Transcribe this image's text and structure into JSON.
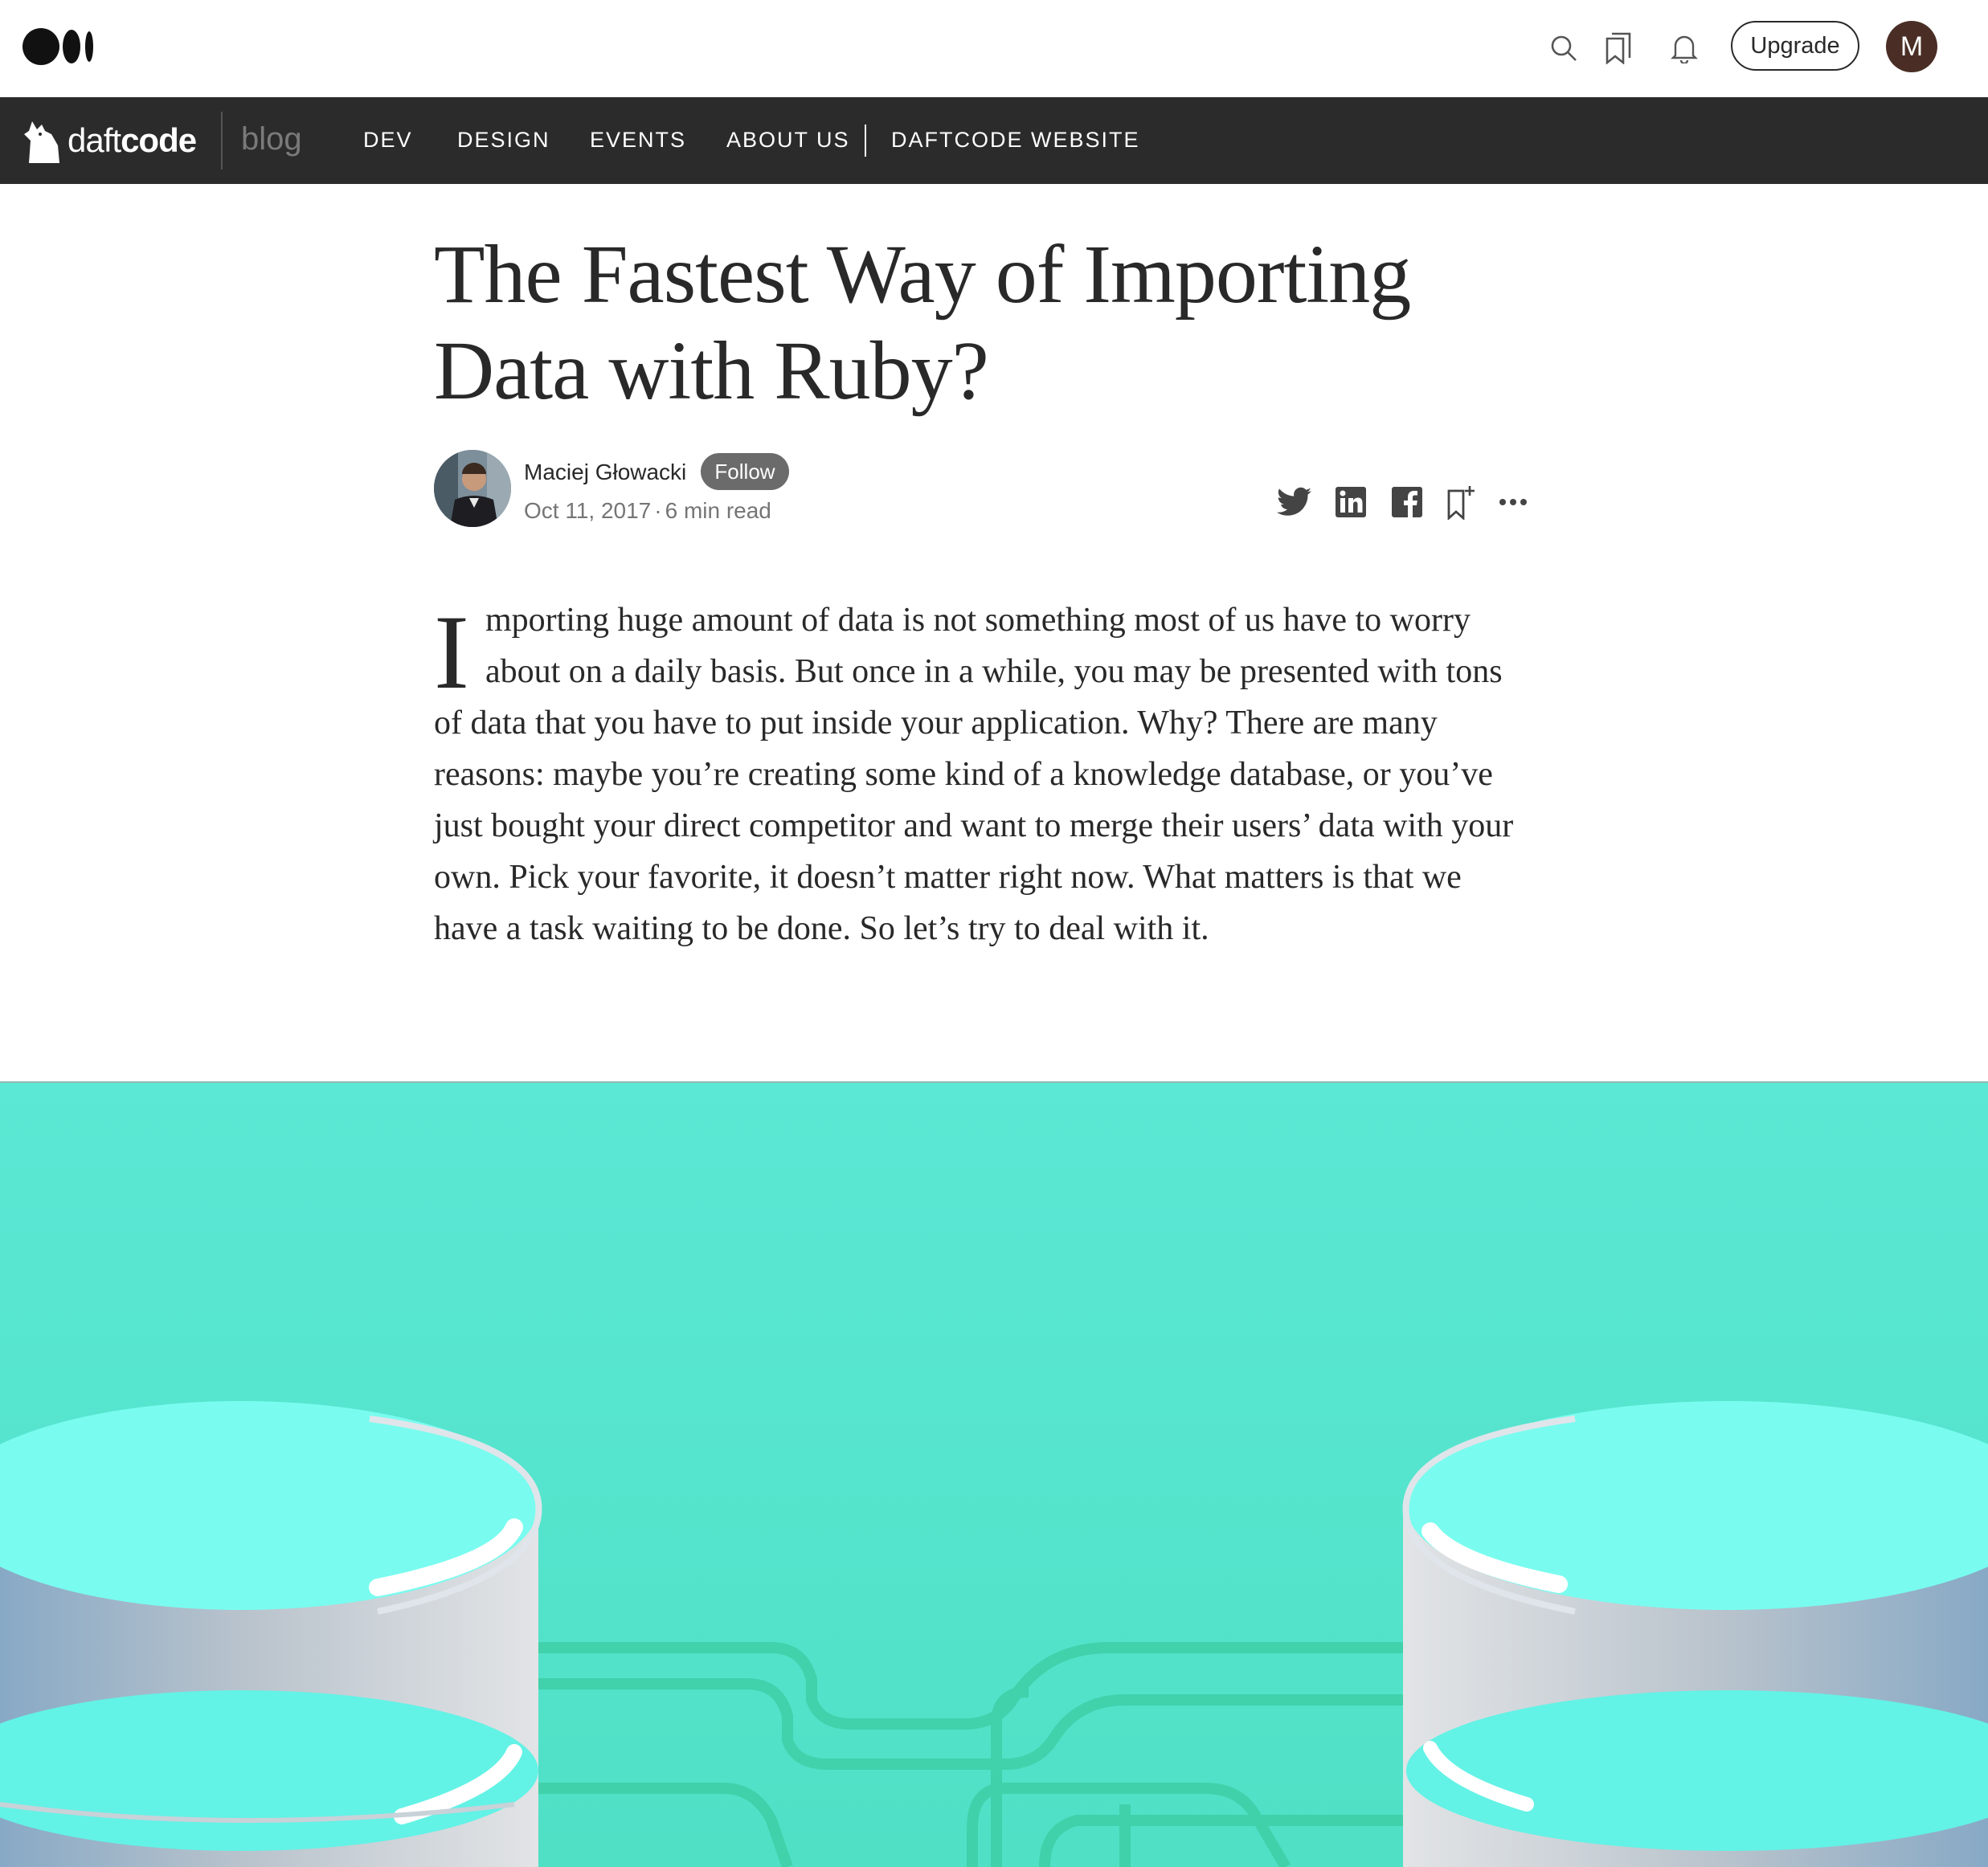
{
  "topbar": {
    "logo": "medium-logo",
    "upgrade_label": "Upgrade",
    "avatar_initial": "M",
    "icons": [
      "search-icon",
      "bookmarks-icon",
      "bell-icon"
    ]
  },
  "publication": {
    "name_light": "daft",
    "name_bold": "code",
    "blog_label": "blog",
    "nav": [
      "DEV",
      "DESIGN",
      "EVENTS",
      "ABOUT US",
      "DAFTCODE WEBSITE"
    ]
  },
  "article": {
    "title": "The Fastest Way of Importing Data with Ruby?",
    "author": "Maciej Głowacki",
    "follow_label": "Follow",
    "date": "Oct 11, 2017",
    "read_time": "6 min read",
    "dropcap": "I",
    "body": "mporting huge amount of data is not something most of us have to worry about on a daily basis. But once in a while, you may be presented with tons of data that you have to put inside your application. Why? There are many reasons: maybe you’re creating some kind of a knowledge database, or you’ve just bought your direct competitor and want to merge their users’ data with your own. Pick your favorite, it doesn’t matter right now. What matters is that we have a task waiting to be done. So let’s try to deal with it."
  },
  "share_icons": [
    "twitter-icon",
    "linkedin-icon",
    "facebook-icon",
    "bookmark-add-icon",
    "more-icon"
  ],
  "colors": {
    "nav_bg": "#2b2b2b",
    "hero_bg": "#57e6cf",
    "text": "#292929",
    "avatar_bg": "#4a2e25"
  }
}
